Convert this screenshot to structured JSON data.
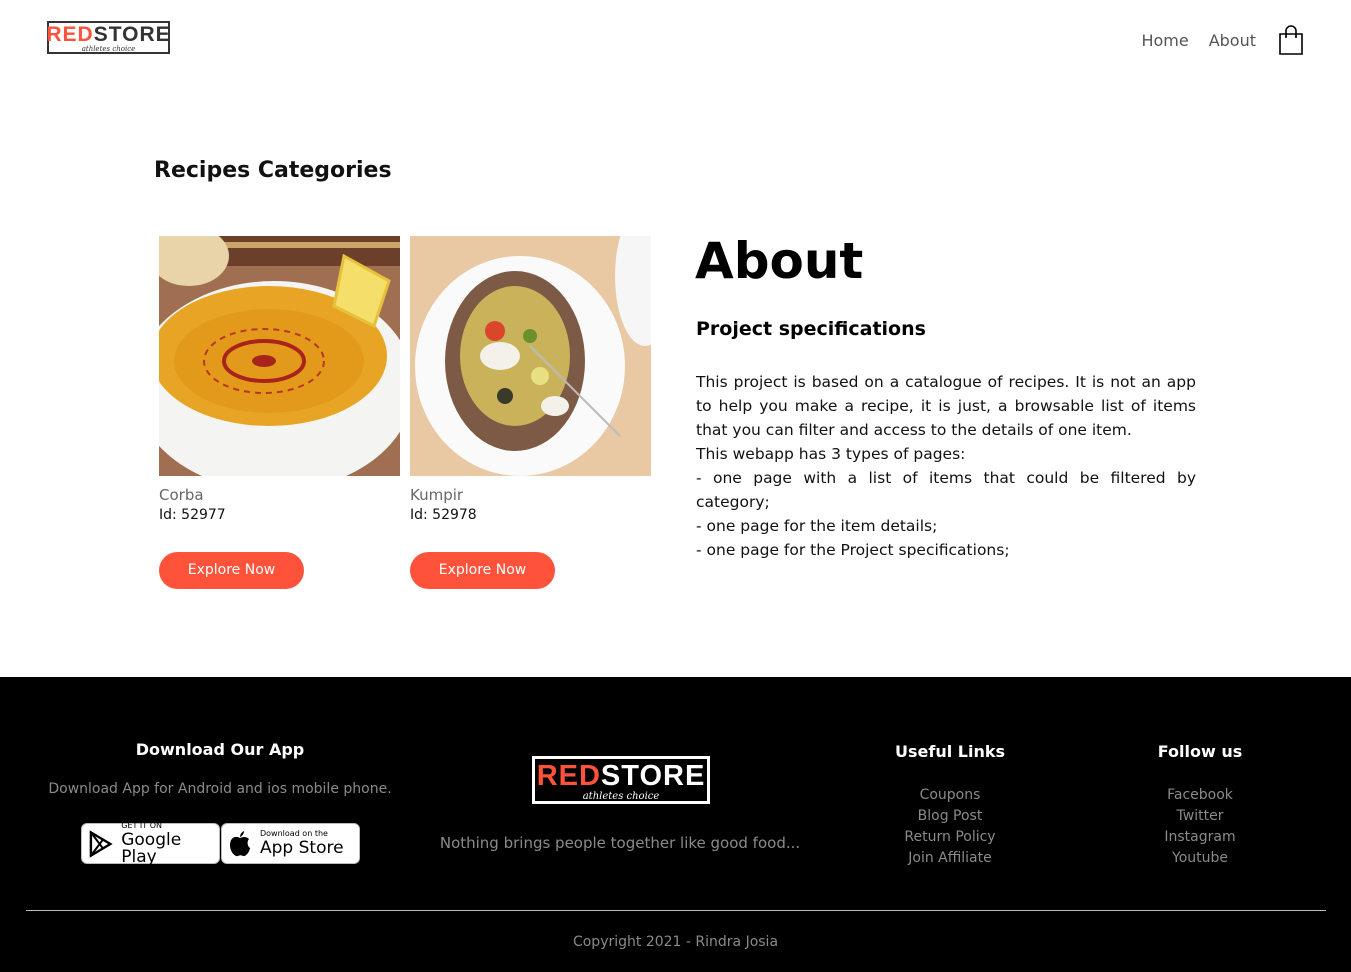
{
  "header": {
    "logo": {
      "red": "RED",
      "rest": "STORE",
      "tagline": "athletes choice"
    },
    "nav": [
      "Home",
      "About"
    ]
  },
  "categories": {
    "title": "Recipes Categories",
    "cards": [
      {
        "name": "Corba",
        "id_label": "Id: 52977",
        "button": "Explore Now"
      },
      {
        "name": "Kumpir",
        "id_label": "Id: 52978",
        "button": "Explore Now"
      }
    ]
  },
  "about": {
    "title": "About",
    "subtitle": "Project specifications",
    "lines": [
      "This project is based on a catalogue of recipes. It is not an app to help you make a recipe, it is just, a browsable list of items that you can filter and access to the details of one item.",
      "This webapp has 3 types of pages:",
      "- one page with a list of items that could be filtered by category;",
      "- one page for the item details;",
      "- one page for the Project specifications;"
    ]
  },
  "footer": {
    "download": {
      "title": "Download Our App",
      "text": "Download App for Android and ios mobile phone.",
      "google": {
        "small": "GET IT ON",
        "big": "Google Play"
      },
      "apple": {
        "small": "Download on the",
        "big": "App Store"
      }
    },
    "brand": {
      "red": "RED",
      "rest": "STORE",
      "tagline": "athletes choice",
      "text": "Nothing brings people together like good food..."
    },
    "useful_links": {
      "title": "Useful Links",
      "items": [
        "Coupons",
        "Blog Post",
        "Return Policy",
        "Join Affiliate"
      ]
    },
    "follow": {
      "title": "Follow us",
      "items": [
        "Facebook",
        "Twitter",
        "Instagram",
        "Youtube"
      ]
    },
    "copyright": "Copyright 2021 - Rindra Josia"
  },
  "colors": {
    "accent": "#ff523b",
    "footer_bg": "#000000"
  }
}
